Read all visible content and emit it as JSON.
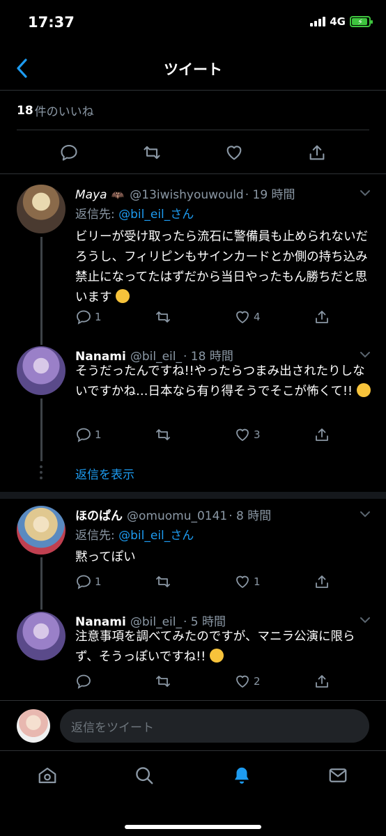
{
  "status": {
    "time": "17:37",
    "network": "4G"
  },
  "header": {
    "title": "ツイート"
  },
  "likes": {
    "count": "18",
    "label": "件のいいね"
  },
  "tweets": [
    {
      "name": "Maya",
      "handle": "@13iwishyouwould",
      "time": "· 19 時間",
      "reply_prefix": "返信先:",
      "reply_mention": "@bil_eil_さん",
      "text": "ビリーが受け取ったら流石に警備員も止められないだろうし、フィリピンもサインカードとか側の持ち込み禁止になってたはずだから当日やったもん勝ちだと思います",
      "replies": "1",
      "retweets": "",
      "likes": "4"
    },
    {
      "name": "Nanami",
      "handle": "@bil_eil_",
      "time": "· 18 時間",
      "text": "そうだったんですね!!やったらつまみ出されたりしないですかね…日本なら有り得そうでそこが怖くて!!",
      "replies": "1",
      "retweets": "",
      "likes": "3"
    },
    {
      "name": "ほのぱん",
      "handle": "@omuomu_0141",
      "time": "· 8 時間",
      "reply_prefix": "返信先:",
      "reply_mention": "@bil_eil_さん",
      "text": "黙ってぽい",
      "replies": "1",
      "retweets": "",
      "likes": "1"
    },
    {
      "name": "Nanami",
      "handle": "@bil_eil_",
      "time": "· 5 時間",
      "text": "注意事項を調べてみたのですが、マニラ公演に限らず、そうっぽいですね!!",
      "replies": "",
      "retweets": "",
      "likes": "2"
    }
  ],
  "show_replies": "返信を表示",
  "compose": {
    "placeholder": "返信をツイート"
  },
  "colors": {
    "accent": "#1d9bf0",
    "muted": "#8b98a5",
    "background": "#000000"
  }
}
